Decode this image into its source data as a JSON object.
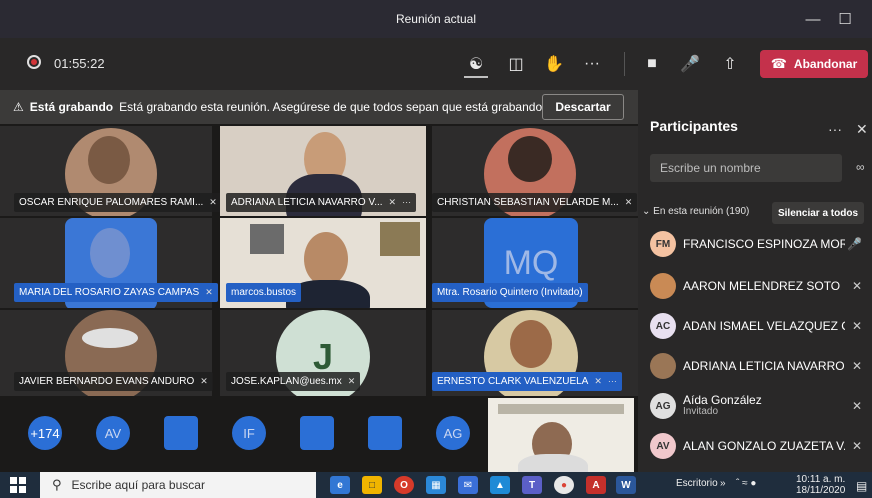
{
  "window": {
    "title": "Reunión actual",
    "minimize_icon": "minimize-icon",
    "maximize_icon": "maximize-icon"
  },
  "toolbar": {
    "timer": "01:55:22",
    "leave_label": "Abandonar"
  },
  "banner": {
    "bold": "Está grabando",
    "text": "Está grabando esta reunión. Asegúrese de que todos sepan que está grabando. ...",
    "dismiss": "Descartar"
  },
  "tiles": [
    {
      "name": "OSCAR ENRIQUE PALOMARES RAMI..."
    },
    {
      "name": "ADRIANA LETICIA NAVARRO V...",
      "more": "···"
    },
    {
      "name": "CHRISTIAN SEBASTIAN VELARDE M..."
    },
    {
      "name": "MARIA DEL ROSARIO ZAYAS CAMPAS"
    },
    {
      "name": "marcos.bustos"
    },
    {
      "name": "Mtra. Rosario Quintero (Invitado)",
      "initials": "MQ"
    },
    {
      "name": "JAVIER BERNARDO EVANS ANDURO"
    },
    {
      "name": "JOSE.KAPLAN@ues.mx",
      "initials": "J"
    },
    {
      "name": "ERNESTO CLARK VALENZUELA",
      "more": "···"
    }
  ],
  "strip": {
    "overflow": "+174",
    "items": [
      "AV",
      "IF",
      "AG"
    ]
  },
  "panel": {
    "title": "Participantes",
    "more": "···",
    "search_placeholder": "Escribe un nombre",
    "in_meeting": "En esta reunión (190)",
    "mute_all": "Silenciar a todos",
    "people": [
      {
        "initials": "FM",
        "name": "FRANCISCO ESPINOZA MOR...",
        "color": "#f4c2a1",
        "mic": "on"
      },
      {
        "initials": "",
        "name": "AARON MELENDREZ SOTO",
        "color": "#c98a55",
        "mic": "off"
      },
      {
        "initials": "AC",
        "name": "ADAN ISMAEL VELAZQUEZ C...",
        "color": "#e8e0f0",
        "mic": "off"
      },
      {
        "initials": "",
        "name": "ADRIANA LETICIA NAVARRO ...",
        "color": "#9a7656",
        "mic": "off"
      },
      {
        "initials": "AG",
        "name": "Aída González",
        "sub": "Invitado",
        "color": "#e0e0e0",
        "mic": "off"
      },
      {
        "initials": "AV",
        "name": "ALAN GONZALO ZUAZETA V...",
        "color": "#f0c8cc",
        "mic": "off"
      }
    ]
  },
  "taskbar": {
    "search": "Escribe aquí para buscar",
    "desktop": "Escritorio",
    "time": "10:11 a. m.",
    "date": "18/11/2020"
  }
}
